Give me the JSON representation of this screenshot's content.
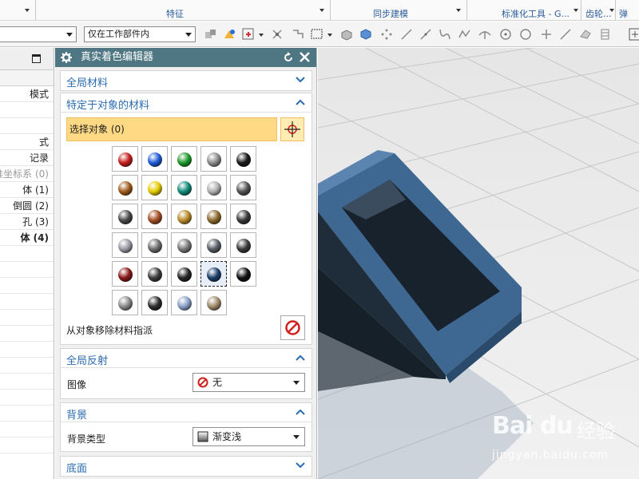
{
  "ribbon": {
    "groups": [
      "特征",
      "同步建模",
      "标准化工具 - G...",
      "齿轮...",
      "弹"
    ]
  },
  "toolbar": {
    "scope_combo": "仅在工作部件内"
  },
  "navigator": {
    "rows": [
      "",
      "模式",
      "",
      "",
      "式",
      "记录",
      "准坐标系 (0)",
      "体 (1)",
      "倒圆 (2)",
      "孔 (3)",
      "体 (4)"
    ]
  },
  "dialog": {
    "title": "真实着色编辑器",
    "global_material": {
      "title": "全局材料"
    },
    "object_material": {
      "title": "特定于对象的材料",
      "select_label": "选择对象 (0)",
      "remove_label": "从对象移除材料指派",
      "swatches": [
        {
          "name": "red",
          "color": "#c81e1e"
        },
        {
          "name": "blue",
          "color": "#1f5bd8"
        },
        {
          "name": "green",
          "color": "#1e9a2a"
        },
        {
          "name": "silver",
          "color": "#8c8c8c"
        },
        {
          "name": "black",
          "color": "#1a1a1a"
        },
        {
          "name": "bronze",
          "color": "#a05a1c"
        },
        {
          "name": "yellow",
          "color": "#e6cc00"
        },
        {
          "name": "teal",
          "color": "#128a7a"
        },
        {
          "name": "chrome",
          "color": "#b0b0b0"
        },
        {
          "name": "dark-grey",
          "color": "#555555"
        },
        {
          "name": "gunmetal",
          "color": "#4a4a4a"
        },
        {
          "name": "copper",
          "color": "#a44e24"
        },
        {
          "name": "gold",
          "color": "#b98a2a"
        },
        {
          "name": "brass",
          "color": "#8c6a2e"
        },
        {
          "name": "graphite",
          "color": "#3a3a3a"
        },
        {
          "name": "brushed-silver",
          "color": "#9a9aa6"
        },
        {
          "name": "satin-grey",
          "color": "#6e6e6e"
        },
        {
          "name": "pewter",
          "color": "#7a7a7a"
        },
        {
          "name": "steel",
          "color": "#5a6068"
        },
        {
          "name": "dark-steel",
          "color": "#3c3c3c"
        },
        {
          "name": "red-glass",
          "color": "#8a1a1a"
        },
        {
          "name": "smoke-glass",
          "color": "#3e3e3e"
        },
        {
          "name": "black-glass",
          "color": "#262626"
        },
        {
          "name": "blue-glass",
          "color": "#1e3f6a"
        },
        {
          "name": "onyx",
          "color": "#121212"
        },
        {
          "name": "light-grey",
          "color": "#8a8a8a"
        },
        {
          "name": "charcoal",
          "color": "#2e2e2e"
        },
        {
          "name": "ice-blue",
          "color": "#8aa0c8"
        },
        {
          "name": "champagne",
          "color": "#a08a6a"
        }
      ],
      "selected_swatch": "blue-glass"
    },
    "global_reflection": {
      "title": "全局反射",
      "image_label": "图像",
      "image_value": "无"
    },
    "background": {
      "title": "背景",
      "type_label": "背景类型",
      "type_value": "渐变浅"
    },
    "floor": {
      "title": "底面"
    }
  },
  "viewport": {
    "model_color": "#2a4a66",
    "watermark_logo": "Bai du",
    "watermark_text": "经验",
    "watermark_url": "jingyan.baidu.com"
  }
}
